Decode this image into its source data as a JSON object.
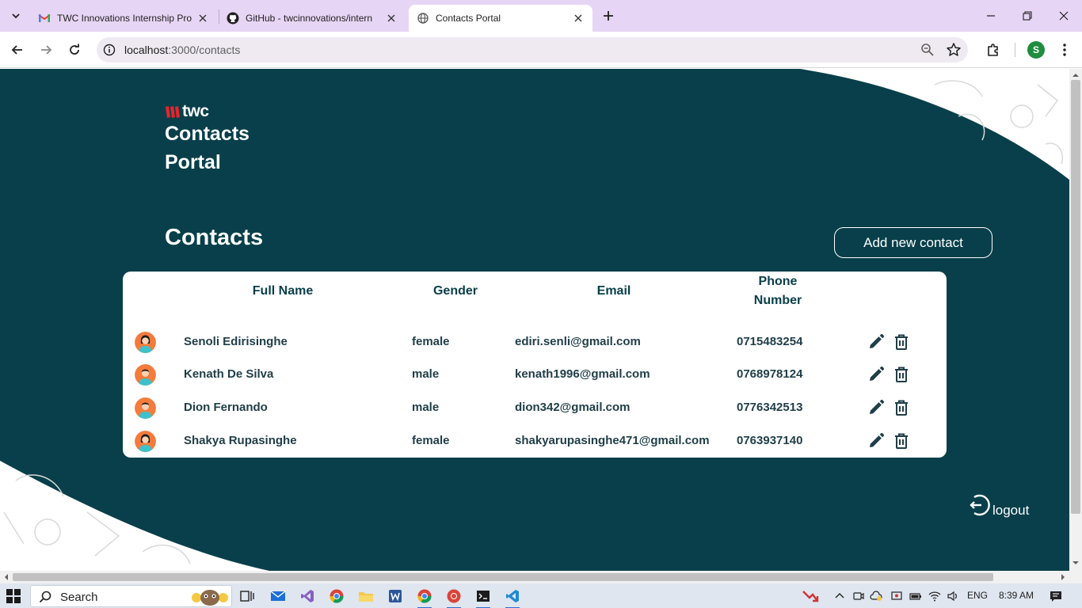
{
  "browser": {
    "tabs": [
      {
        "title": "TWC Innovations Internship Pro",
        "favicon": "gmail-icon",
        "active": false
      },
      {
        "title": "GitHub - twcinnovations/intern",
        "favicon": "github-icon",
        "active": false
      },
      {
        "title": "Contacts Portal",
        "favicon": "globe-icon",
        "active": true
      }
    ],
    "url_host": "localhost",
    "url_path": ":3000/contacts",
    "profile_initial": "S"
  },
  "page": {
    "logo_text": "twc",
    "brand_title": "Contacts Portal",
    "heading": "Contacts",
    "add_button_label": "Add new contact",
    "logout_label": "logout",
    "colors": {
      "background": "#083f4a",
      "accent": "#e8242c",
      "text_dark": "#083f4a"
    },
    "table": {
      "headers": {
        "name": "Full Name",
        "gender": "Gender",
        "email": "Email",
        "phone": "Phone Number"
      },
      "rows": [
        {
          "name": "Senoli Edirisinghe",
          "gender": "female",
          "email": "ediri.senli@gmail.com",
          "phone": "0715483254",
          "avatar": "female-avatar"
        },
        {
          "name": "Kenath De Silva",
          "gender": "male",
          "email": "kenath1996@gmail.com",
          "phone": "0768978124",
          "avatar": "male-avatar"
        },
        {
          "name": "Dion Fernando",
          "gender": "male",
          "email": "dion342@gmail.com",
          "phone": "0776342513",
          "avatar": "male-avatar"
        },
        {
          "name": "Shakya Rupasinghe",
          "gender": "female",
          "email": "shakyarupasinghe471@gmail.com",
          "phone": "0763937140",
          "avatar": "female-avatar"
        }
      ]
    }
  },
  "taskbar": {
    "search_label": "Search",
    "language": "ENG",
    "time": "8:39 AM"
  }
}
